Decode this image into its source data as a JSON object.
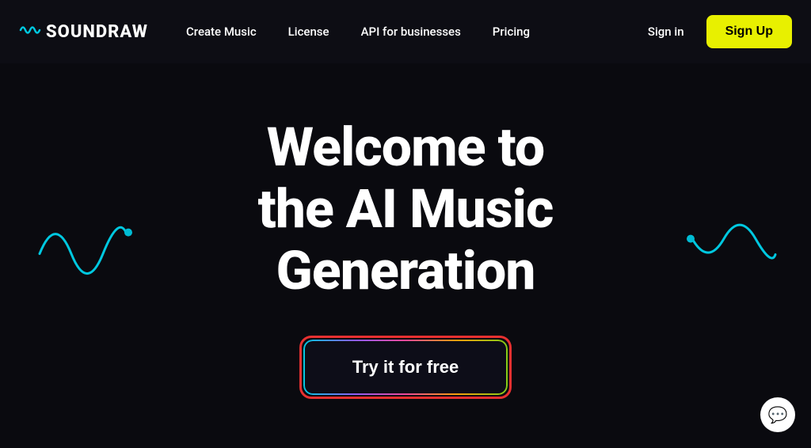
{
  "logo": {
    "icon": "∿",
    "text": "SOUNDRAW"
  },
  "nav": {
    "links": [
      {
        "label": "Create Music",
        "id": "create-music"
      },
      {
        "label": "License",
        "id": "license"
      },
      {
        "label": "API for businesses",
        "id": "api-businesses"
      },
      {
        "label": "Pricing",
        "id": "pricing"
      }
    ],
    "sign_in": "Sign in",
    "sign_up": "Sign Up"
  },
  "hero": {
    "title": "Welcome to\nthe AI Music\nGeneration",
    "cta_label": "Try it for free"
  },
  "colors": {
    "accent_yellow": "#e8f000",
    "accent_teal": "#00c8e0",
    "background": "#0a0a0f",
    "text_primary": "#ffffff"
  }
}
